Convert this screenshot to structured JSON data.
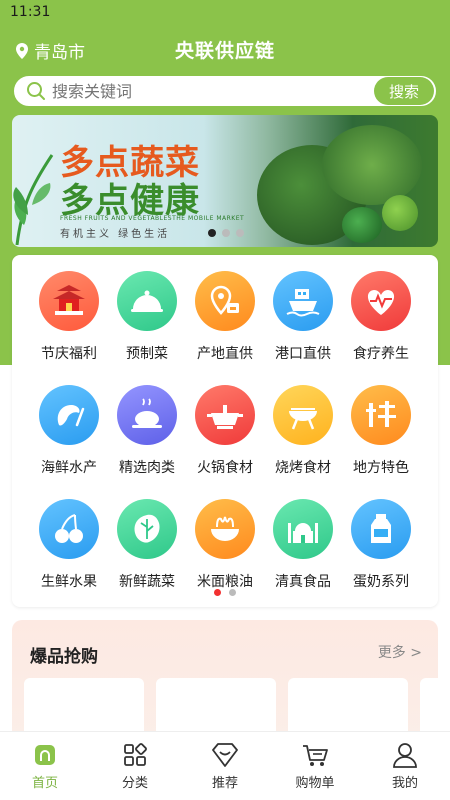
{
  "status_bar": {
    "time": "11:31"
  },
  "header": {
    "location": "青岛市",
    "title": "央联供应链"
  },
  "search": {
    "placeholder": "搜索关键词",
    "button_label": "搜索"
  },
  "banner": {
    "line1": "多点蔬菜",
    "line2": "多点健康",
    "subtitle": "FRESH FRUITS AND VEGETABLESTHE MOBILE MARKET",
    "tags": "有机主义  绿色生活",
    "slide_count": 3,
    "active_slide": 0
  },
  "categories": [
    {
      "label": "节庆福利",
      "icon": "pagoda-icon",
      "color": "#ff6f4e"
    },
    {
      "label": "预制菜",
      "icon": "cloche-icon",
      "color": "#3fd39a"
    },
    {
      "label": "产地直供",
      "icon": "location-shop-icon",
      "color": "#ff9d2e"
    },
    {
      "label": "港口直供",
      "icon": "ship-icon",
      "color": "#35aef5"
    },
    {
      "label": "食疗养生",
      "icon": "heart-pulse-icon",
      "color": "#ff5252"
    },
    {
      "label": "海鲜水产",
      "icon": "shrimp-icon",
      "color": "#35aef5"
    },
    {
      "label": "精选肉类",
      "icon": "roast-chicken-icon",
      "color": "#7b7cf5"
    },
    {
      "label": "火锅食材",
      "icon": "hotpot-icon",
      "color": "#ff5252"
    },
    {
      "label": "烧烤食材",
      "icon": "grill-icon",
      "color": "#ffc233"
    },
    {
      "label": "地方特色",
      "icon": "special-char-icon",
      "color": "#ff9d2e"
    },
    {
      "label": "生鲜水果",
      "icon": "cherry-icon",
      "color": "#35aef5"
    },
    {
      "label": "新鲜蔬菜",
      "icon": "cabbage-icon",
      "color": "#3fd39a"
    },
    {
      "label": "米面粮油",
      "icon": "noodle-bowl-icon",
      "color": "#ff9d2e"
    },
    {
      "label": "清真食品",
      "icon": "mosque-icon",
      "color": "#3fd39a"
    },
    {
      "label": "蛋奶系列",
      "icon": "milk-bottle-icon",
      "color": "#35aef5"
    }
  ],
  "category_pages": {
    "count": 2,
    "active": 0
  },
  "hot_sale": {
    "title": "爆品抢购",
    "more_label": "更多 >"
  },
  "tabs": [
    {
      "label": "首页",
      "icon": "home-icon",
      "active": true
    },
    {
      "label": "分类",
      "icon": "category-icon",
      "active": false
    },
    {
      "label": "推荐",
      "icon": "recommend-icon",
      "active": false
    },
    {
      "label": "购物单",
      "icon": "cart-icon",
      "active": false
    },
    {
      "label": "我的",
      "icon": "user-icon",
      "active": false
    }
  ],
  "colors": {
    "brand_green": "#8bc34a",
    "active_tab": "#7cb342",
    "dot_active": "#f23030"
  }
}
